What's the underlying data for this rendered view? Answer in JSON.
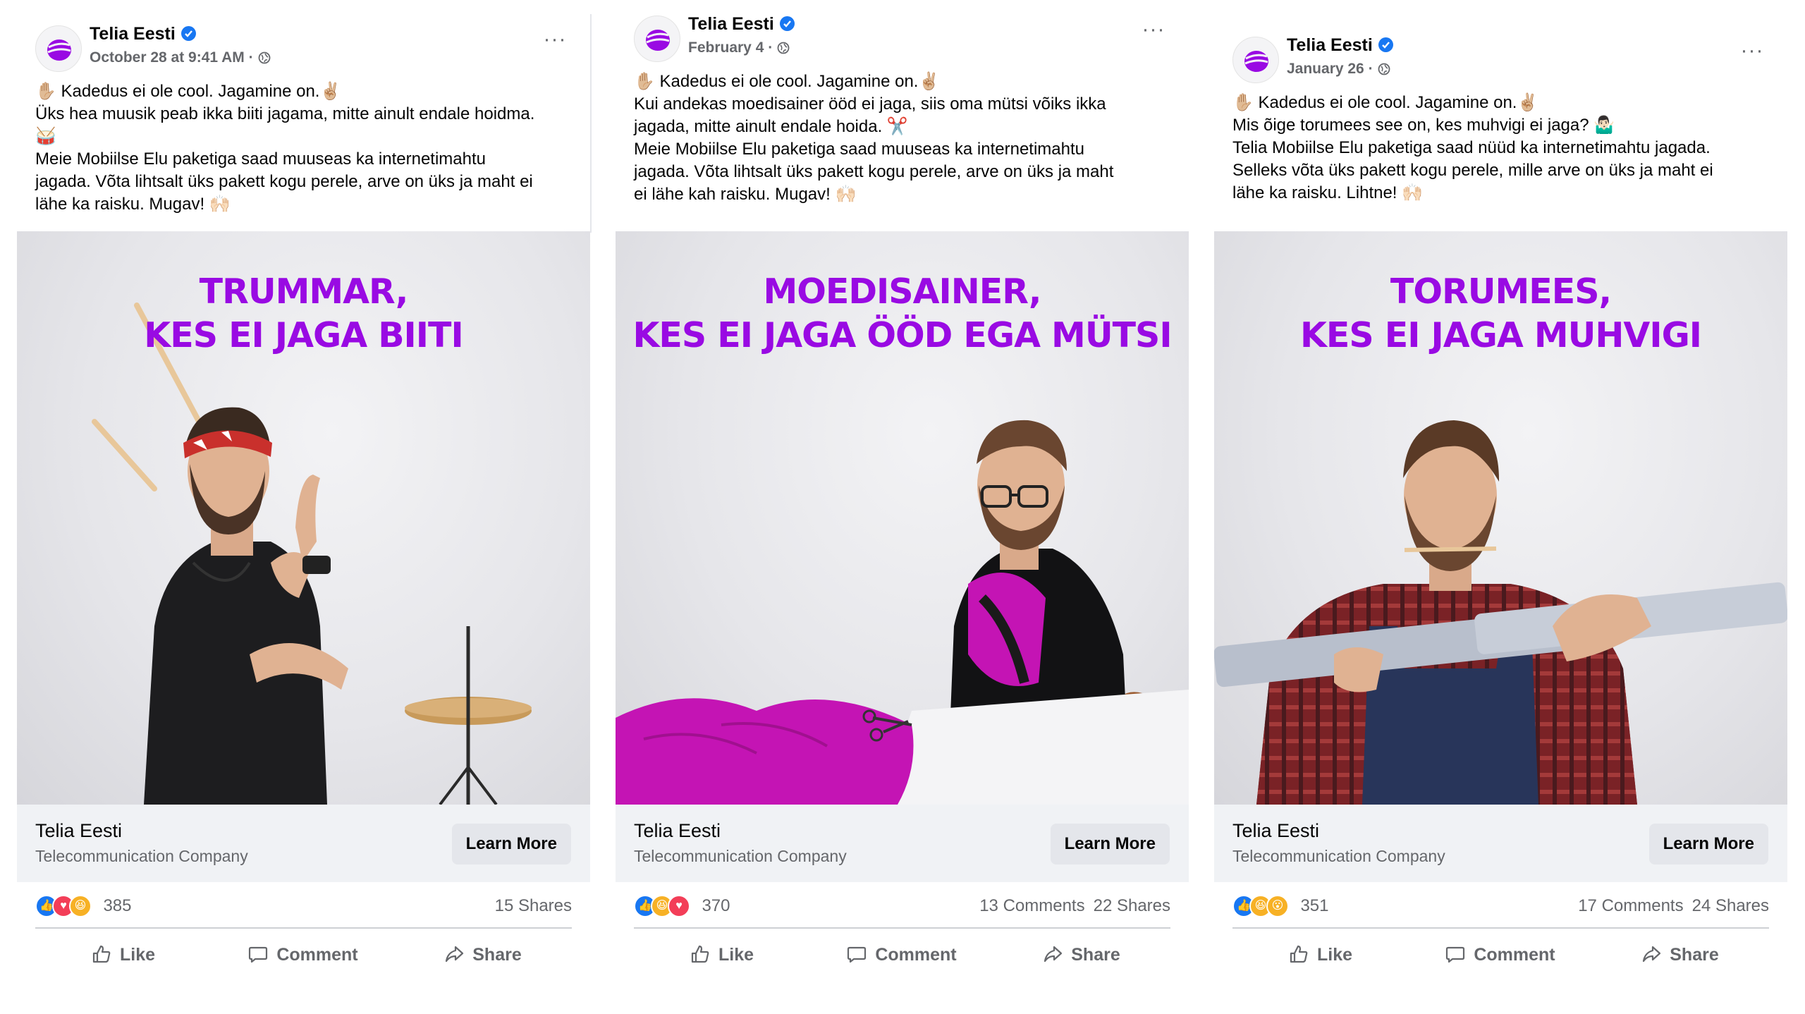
{
  "accent_color": "#990ae3",
  "link_color": "#1877f2",
  "posts": [
    {
      "page_name": "Telia Eesti",
      "date": "October 28 at 9:41 AM",
      "text_lines": [
        "✋🏼 Kadedus ei ole cool. Jagamine on.✌🏼",
        "Üks hea muusik peab ikka biiti jagama, mitte ainult endale hoidma.",
        "🥁",
        "Meie Mobiilse Elu paketiga saad muuseas ka internetimahtu",
        "jagada. Võta lihtsalt üks pakett kogu perele, arve on üks ja maht ei",
        "lähe ka raisku. Mugav! 🙌🏻"
      ],
      "headline": [
        "TRUMMAR,",
        "KES EI JAGA BIITI"
      ],
      "cta": {
        "name": "Telia Eesti",
        "category": "Telecommunication Company",
        "button": "Learn More"
      },
      "reactions": [
        "like",
        "love",
        "haha"
      ],
      "reaction_count": "385",
      "comments": "",
      "shares": "15 Shares",
      "actions": {
        "like": "Like",
        "comment": "Comment",
        "share": "Share"
      }
    },
    {
      "page_name": "Telia Eesti",
      "date": "February 4",
      "text_lines": [
        "✋🏼 Kadedus ei ole cool. Jagamine on.✌🏼",
        "Kui andekas moedisainer ööd ei jaga, siis oma mütsi võiks ikka",
        "jagada, mitte ainult endale hoida. ✂️",
        "Meie Mobiilse Elu paketiga saad muuseas ka internetimahtu",
        "jagada. Võta lihtsalt üks pakett kogu perele, arve on üks ja maht",
        "ei lähe kah raisku. Mugav! 🙌🏻"
      ],
      "headline": [
        "MOEDISAINER,",
        "KES EI JAGA ÖÖD EGA MÜTSI"
      ],
      "cta": {
        "name": "Telia Eesti",
        "category": "Telecommunication Company",
        "button": "Learn More"
      },
      "reactions": [
        "like",
        "haha",
        "love"
      ],
      "reaction_count": "370",
      "comments": "13 Comments",
      "shares": "22 Shares",
      "actions": {
        "like": "Like",
        "comment": "Comment",
        "share": "Share"
      }
    },
    {
      "page_name": "Telia Eesti",
      "date": "January 26",
      "text_lines": [
        "✋🏼 Kadedus ei ole cool. Jagamine on.✌🏼",
        "Mis õige torumees see on, kes muhvigi ei jaga? 🤷🏻‍♂️",
        "Telia Mobiilse Elu paketiga saad nüüd ka internetimahtu jagada.",
        "Selleks võta üks pakett kogu perele, mille arve on üks ja maht ei",
        "lähe ka raisku. Lihtne! 🙌🏻"
      ],
      "headline": [
        "TORUMEES,",
        "KES EI JAGA MUHVIGI"
      ],
      "cta": {
        "name": "Telia Eesti",
        "category": "Telecommunication Company",
        "button": "Learn More"
      },
      "reactions": [
        "like",
        "haha",
        "wow"
      ],
      "reaction_count": "351",
      "comments": "17 Comments",
      "shares": "24 Shares",
      "actions": {
        "like": "Like",
        "comment": "Comment",
        "share": "Share"
      }
    }
  ]
}
